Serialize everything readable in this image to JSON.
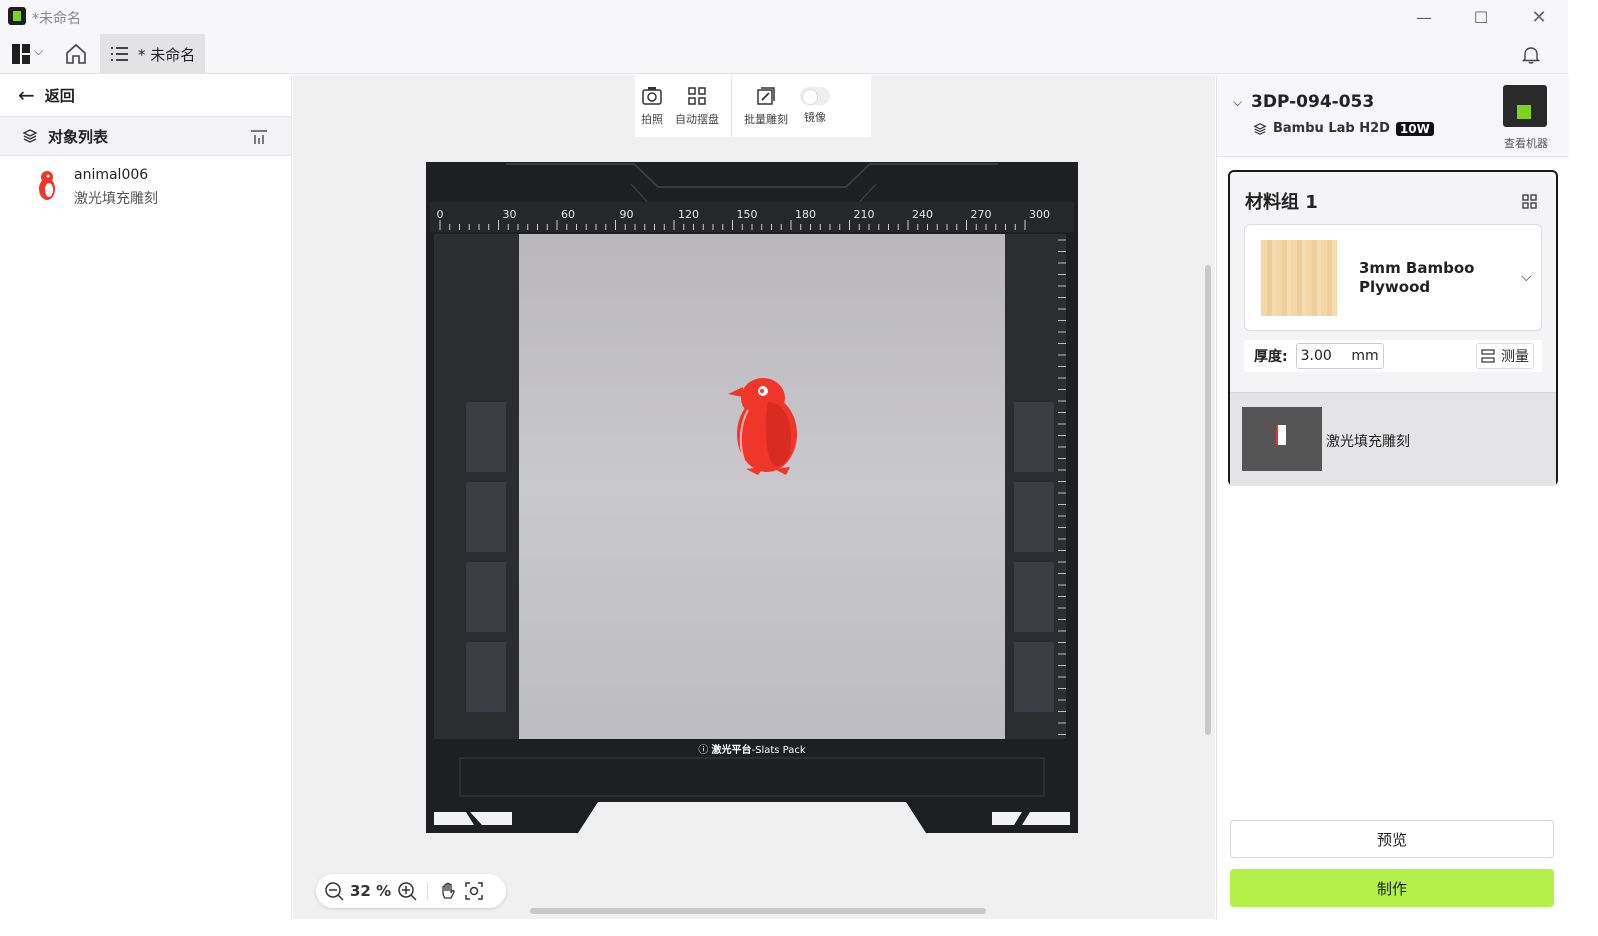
{
  "window": {
    "title": "*未命名",
    "min_icon": "minimize-icon",
    "max_icon": "maximize-icon",
    "close_icon": "close-icon"
  },
  "menubar": {
    "tab_label": "* 未命名"
  },
  "left_panel": {
    "back_label": "返回",
    "object_list_title": "对象列表",
    "objects": [
      {
        "name": "animal006",
        "type": "激光填充雕刻"
      }
    ]
  },
  "toolbar": {
    "photo_label": "拍照",
    "auto_arrange_label": "自动摆盘",
    "batch_engrave_label": "批量雕刻",
    "mirror_label": "镜像"
  },
  "bed": {
    "ruler_ticks": [
      "0",
      "30",
      "60",
      "90",
      "120",
      "150",
      "180",
      "210",
      "240",
      "270",
      "300"
    ],
    "platform_label": "激光平台",
    "platform_sub": "-Slats Pack"
  },
  "zoom": {
    "value": "32 %"
  },
  "right_panel": {
    "device_name": "3DP-094-053",
    "device_model": "Bambu Lab H2D",
    "device_power": "10W",
    "view_machine": "查看机器",
    "material_group_title": "材料组 1",
    "material_name": "3mm Bamboo Plywood",
    "thickness_label": "厚度:",
    "thickness_value": "3.00",
    "thickness_unit": "mm",
    "measure_label": "测量",
    "process_label": "激光填充雕刻",
    "preview_label": "预览",
    "make_label": "制作"
  },
  "colors": {
    "accent": "#b3f04a",
    "penguin": "#f0362b",
    "bed_dark": "#1e1f22"
  }
}
